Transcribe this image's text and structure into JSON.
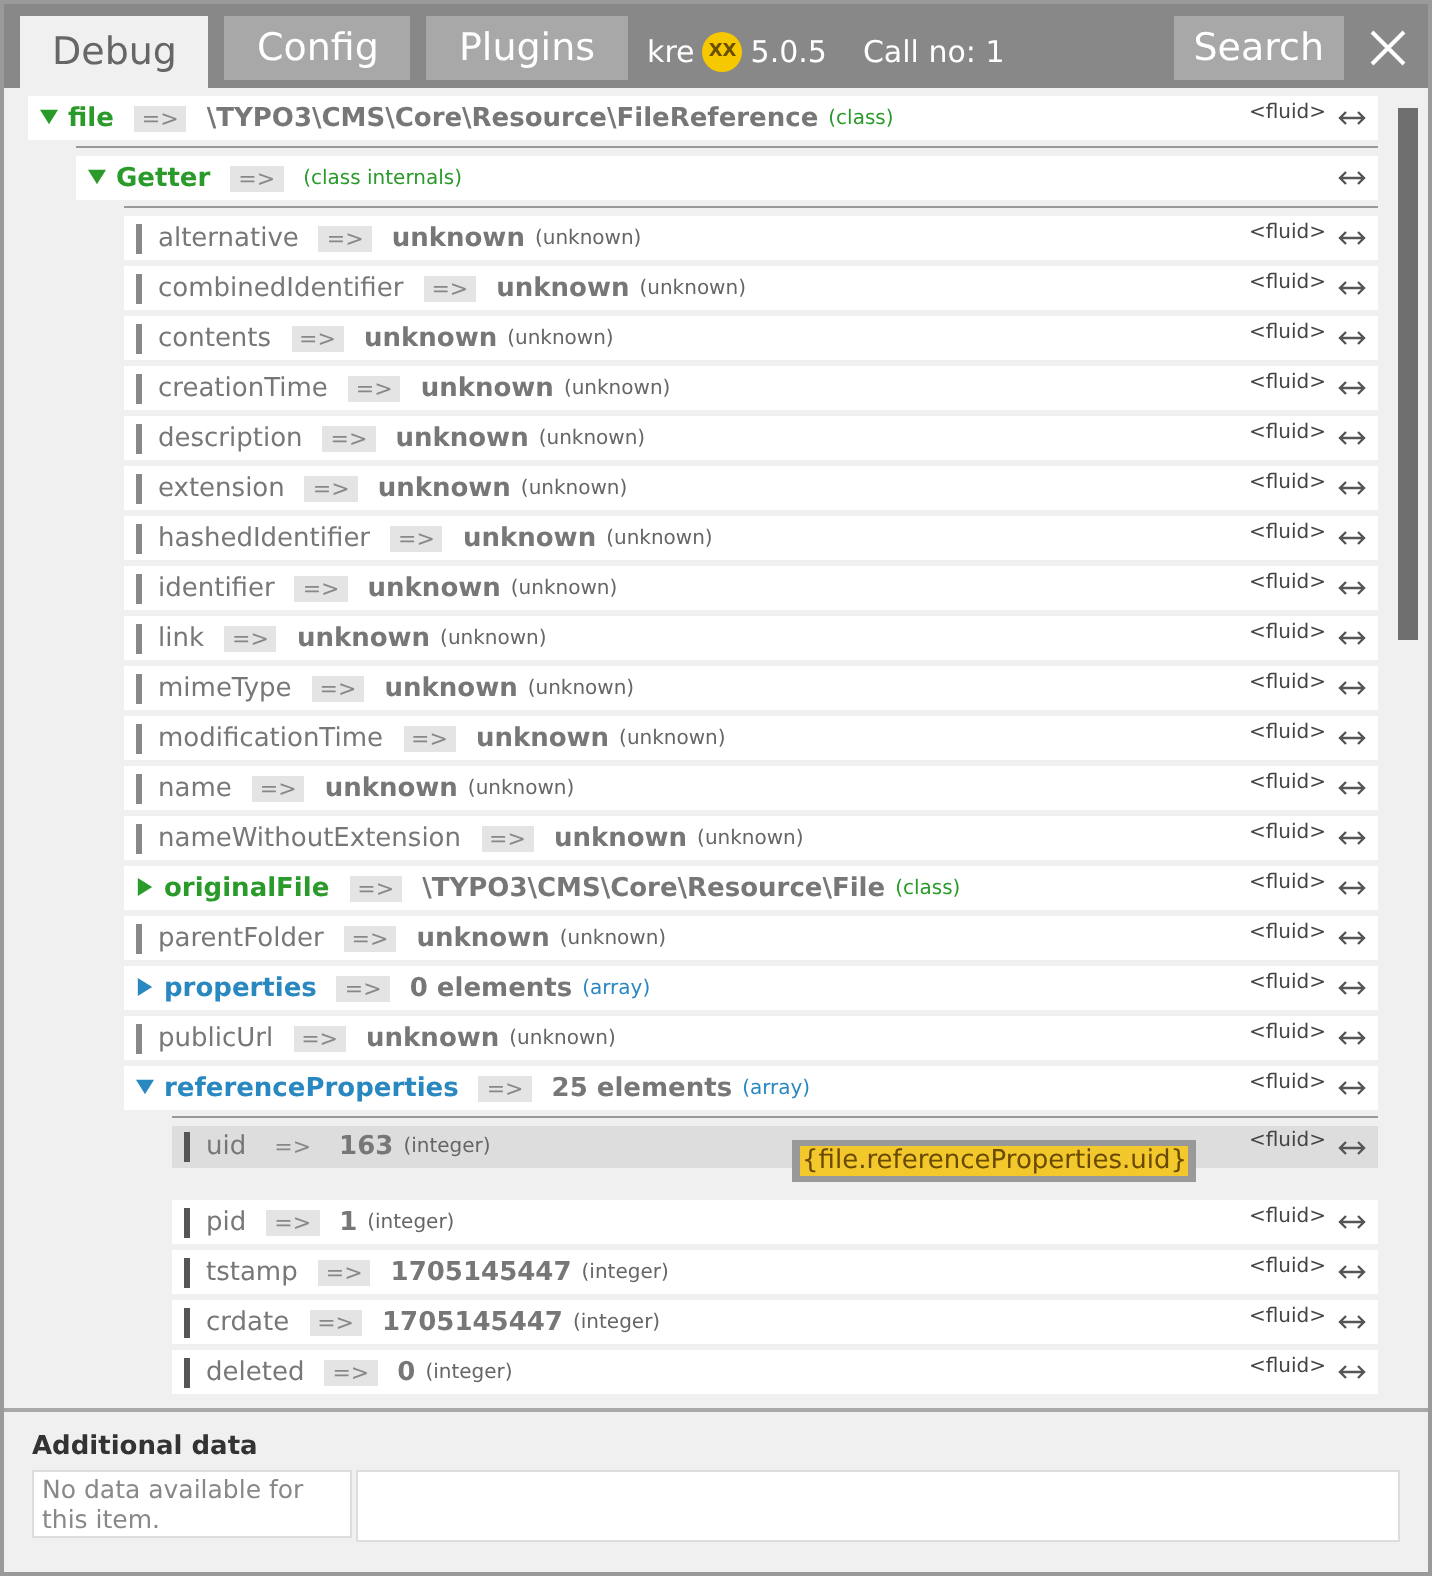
{
  "tabs": [
    {
      "label": "Debug",
      "selected": true
    },
    {
      "label": "Config",
      "selected": false
    },
    {
      "label": "Plugins",
      "selected": false
    }
  ],
  "header": {
    "brand": "kre",
    "logo": "XX",
    "version": "5.0.5",
    "call": "Call no: 1",
    "search": "Search"
  },
  "tree": [
    {
      "name": "file",
      "arrow": "=>",
      "value": "\\TYPO3\\CMS\\Core\\Resource\\FileReference",
      "type": "(class)",
      "kind": "class",
      "expanded": true,
      "fluid": "<fluid>",
      "children": [
        {
          "name": "Getter",
          "arrow": "=>",
          "type": "(class internals)",
          "kind": "class",
          "expanded": true,
          "children": [
            {
              "name": "alternative",
              "arrow": "=>",
              "value": "unknown",
              "type": "(unknown)",
              "kind": "leaf",
              "fluid": "<fluid>"
            },
            {
              "name": "combinedIdentifier",
              "arrow": "=>",
              "value": "unknown",
              "type": "(unknown)",
              "kind": "leaf",
              "fluid": "<fluid>"
            },
            {
              "name": "contents",
              "arrow": "=>",
              "value": "unknown",
              "type": "(unknown)",
              "kind": "leaf",
              "fluid": "<fluid>"
            },
            {
              "name": "creationTime",
              "arrow": "=>",
              "value": "unknown",
              "type": "(unknown)",
              "kind": "leaf",
              "fluid": "<fluid>"
            },
            {
              "name": "description",
              "arrow": "=>",
              "value": "unknown",
              "type": "(unknown)",
              "kind": "leaf",
              "fluid": "<fluid>"
            },
            {
              "name": "extension",
              "arrow": "=>",
              "value": "unknown",
              "type": "(unknown)",
              "kind": "leaf",
              "fluid": "<fluid>"
            },
            {
              "name": "hashedIdentifier",
              "arrow": "=>",
              "value": "unknown",
              "type": "(unknown)",
              "kind": "leaf",
              "fluid": "<fluid>"
            },
            {
              "name": "identifier",
              "arrow": "=>",
              "value": "unknown",
              "type": "(unknown)",
              "kind": "leaf",
              "fluid": "<fluid>"
            },
            {
              "name": "link",
              "arrow": "=>",
              "value": "unknown",
              "type": "(unknown)",
              "kind": "leaf",
              "fluid": "<fluid>"
            },
            {
              "name": "mimeType",
              "arrow": "=>",
              "value": "unknown",
              "type": "(unknown)",
              "kind": "leaf",
              "fluid": "<fluid>"
            },
            {
              "name": "modificationTime",
              "arrow": "=>",
              "value": "unknown",
              "type": "(unknown)",
              "kind": "leaf",
              "fluid": "<fluid>"
            },
            {
              "name": "name",
              "arrow": "=>",
              "value": "unknown",
              "type": "(unknown)",
              "kind": "leaf",
              "fluid": "<fluid>"
            },
            {
              "name": "nameWithoutExtension",
              "arrow": "=>",
              "value": "unknown",
              "type": "(unknown)",
              "kind": "leaf",
              "fluid": "<fluid>"
            },
            {
              "name": "originalFile",
              "arrow": "=>",
              "value": "\\TYPO3\\CMS\\Core\\Resource\\File",
              "type": "(class)",
              "kind": "class",
              "expanded": false,
              "fluid": "<fluid>"
            },
            {
              "name": "parentFolder",
              "arrow": "=>",
              "value": "unknown",
              "type": "(unknown)",
              "kind": "leaf",
              "fluid": "<fluid>"
            },
            {
              "name": "properties",
              "arrow": "=>",
              "value": "0 elements",
              "type": "(array)",
              "kind": "array",
              "expanded": false,
              "fluid": "<fluid>"
            },
            {
              "name": "publicUrl",
              "arrow": "=>",
              "value": "unknown",
              "type": "(unknown)",
              "kind": "leaf",
              "fluid": "<fluid>"
            },
            {
              "name": "referenceProperties",
              "arrow": "=>",
              "value": "25 elements",
              "type": "(array)",
              "kind": "array",
              "expanded": true,
              "fluid": "<fluid>",
              "children": [
                {
                  "name": "uid",
                  "arrow": "=>",
                  "value": "163",
                  "type": "(integer)",
                  "kind": "leaf",
                  "selected": true,
                  "fluid": "<fluid>",
                  "tooltip": "{file.referenceProperties.uid}"
                },
                {
                  "name": "pid",
                  "arrow": "=>",
                  "value": "1",
                  "type": "(integer)",
                  "kind": "leaf",
                  "selected": false,
                  "fluid": "<fluid>"
                },
                {
                  "name": "tstamp",
                  "arrow": "=>",
                  "value": "1705145447",
                  "type": "(integer)",
                  "kind": "leaf",
                  "selected": false,
                  "fluid": "<fluid>"
                },
                {
                  "name": "crdate",
                  "arrow": "=>",
                  "value": "1705145447",
                  "type": "(integer)",
                  "kind": "leaf",
                  "selected": false,
                  "fluid": "<fluid>"
                },
                {
                  "name": "deleted",
                  "arrow": "=>",
                  "value": "0",
                  "type": "(integer)",
                  "kind": "leaf",
                  "selected": false,
                  "fluid": "<fluid>"
                }
              ]
            }
          ]
        }
      ]
    }
  ],
  "additional": {
    "title": "Additional data",
    "message": "No data available for this item."
  }
}
